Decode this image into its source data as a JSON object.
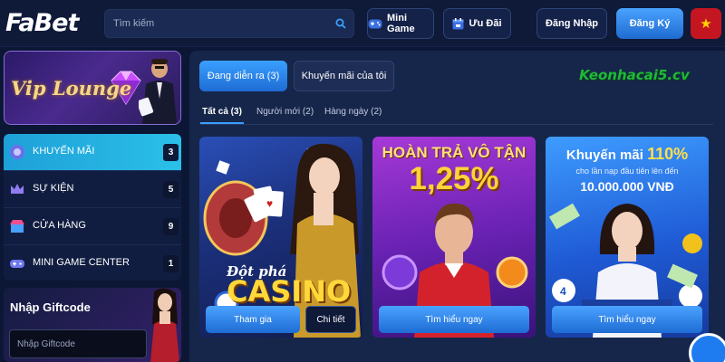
{
  "header": {
    "logo": "FaBet",
    "search_placeholder": "Tìm kiếm",
    "mini_game": "Mini Game",
    "uu_dai": "Ưu Đãi",
    "login": "Đăng Nhập",
    "register": "Đăng Ký"
  },
  "sidebar": {
    "vip_label": "Vip Lounge",
    "items": [
      {
        "label": "KHUYẾN MÃI",
        "count": "3"
      },
      {
        "label": "SỰ KIỆN",
        "count": "5"
      },
      {
        "label": "CỬA HÀNG",
        "count": "9"
      },
      {
        "label": "MINI GAME CENTER",
        "count": "1"
      }
    ],
    "giftcode_title": "Nhập Giftcode",
    "giftcode_placeholder": "Nhập Giftcode"
  },
  "main": {
    "tabs": [
      "Đang diễn ra (3)",
      "Khuyến mãi của tôi"
    ],
    "watermark": "Keonhacai5.cv",
    "subtabs": [
      "Tất cả (3)",
      "Người mới (2)",
      "Hàng ngày (2)"
    ],
    "cards": [
      {
        "line1": "Đột phá",
        "line2": "CASINO",
        "primary_btn": "Tham gia",
        "secondary_btn": "Chi tiết"
      },
      {
        "line1": "HOÀN TRẢ VÔ TẬN",
        "line2": "1,25%",
        "primary_btn": "Tìm hiểu ngay"
      },
      {
        "line1_prefix": "Khuyến mãi",
        "line1_pct": "110%",
        "line2": "cho lần nạp đầu tiên lên đến",
        "line3": "10.000.000 VNĐ",
        "primary_btn": "Tìm hiểu ngay"
      }
    ]
  },
  "colors": {
    "accent": "#2b7fe0",
    "active_menu": "#1ea0d8",
    "background": "#0b1734"
  }
}
